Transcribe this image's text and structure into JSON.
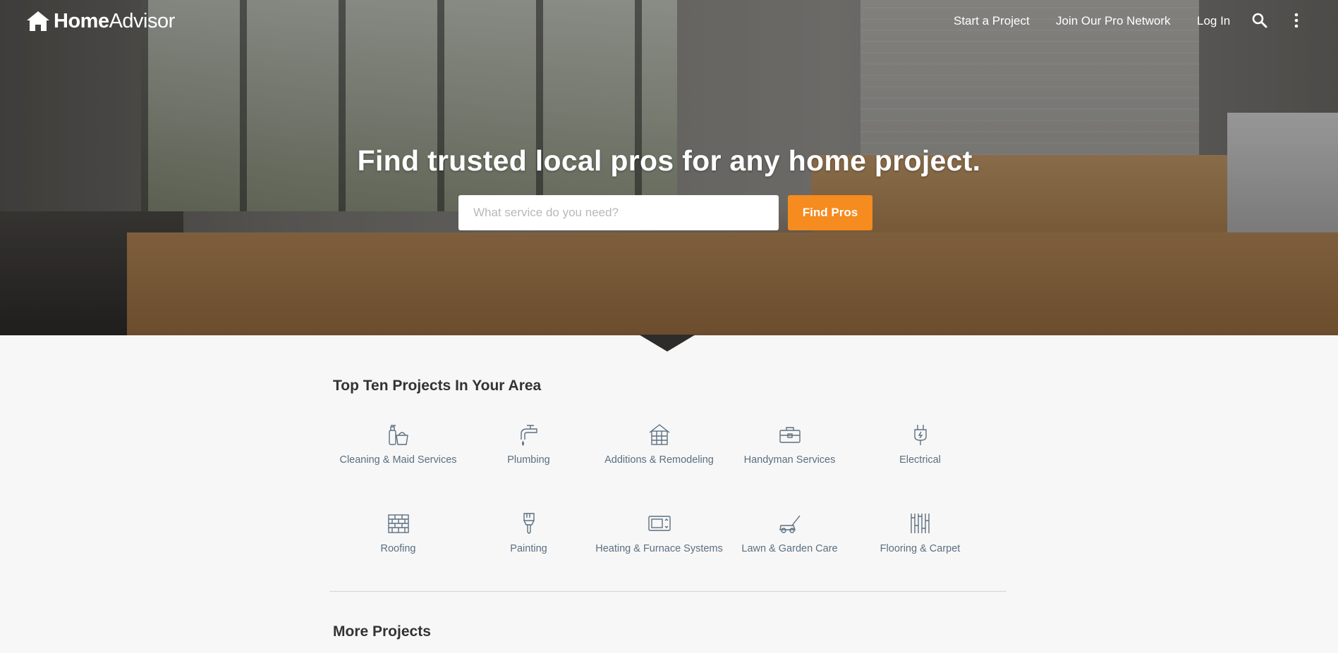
{
  "header": {
    "logo_bold": "Home",
    "logo_light": "Advisor",
    "nav": [
      "Start a Project",
      "Join Our Pro Network",
      "Log In"
    ],
    "icons": [
      "search-icon",
      "more-vertical-icon"
    ]
  },
  "hero": {
    "headline": "Find trusted local pros for any home project.",
    "search_placeholder": "What service do you need?",
    "search_value": "",
    "button_label": "Find Pros"
  },
  "top_projects": {
    "title": "Top Ten Projects In Your Area",
    "items": [
      {
        "label": "Cleaning & Maid Services",
        "icon": "cleaning-supplies-icon"
      },
      {
        "label": "Plumbing",
        "icon": "faucet-icon"
      },
      {
        "label": "Additions & Remodeling",
        "icon": "house-frame-icon"
      },
      {
        "label": "Handyman Services",
        "icon": "toolbox-icon"
      },
      {
        "label": "Electrical",
        "icon": "plug-icon"
      },
      {
        "label": "Roofing",
        "icon": "bricks-icon"
      },
      {
        "label": "Painting",
        "icon": "paintbrush-icon"
      },
      {
        "label": "Heating & Furnace Systems",
        "icon": "thermostat-icon"
      },
      {
        "label": "Lawn & Garden Care",
        "icon": "lawnmower-icon"
      },
      {
        "label": "Flooring & Carpet",
        "icon": "flooring-icon"
      }
    ]
  },
  "more_projects": {
    "title": "More Projects"
  },
  "colors": {
    "accent": "#f68b1f",
    "label_text": "#5b6f80",
    "icon_stroke": "#5b6f80",
    "heading_text": "#333333"
  }
}
